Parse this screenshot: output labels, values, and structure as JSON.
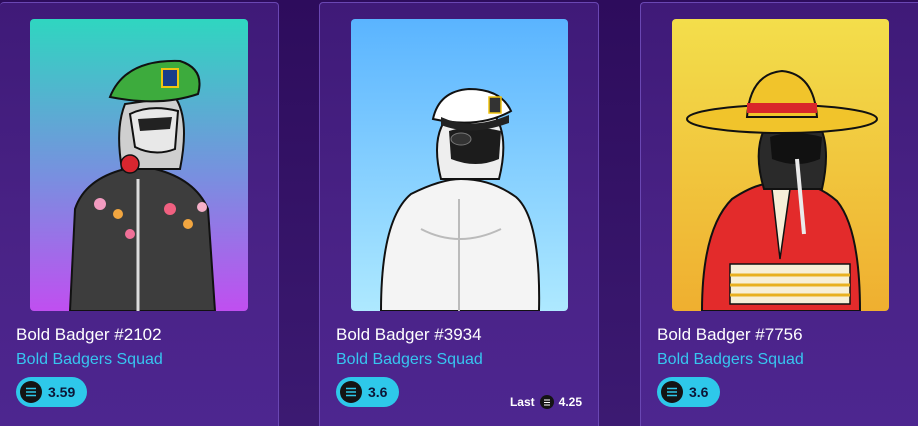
{
  "cards": [
    {
      "title": "Bold Badger #2102",
      "collection": "Bold Badgers Squad",
      "price": "3.59",
      "background": [
        "#2fd6c0",
        "#bd4cf0"
      ],
      "icon": "solana-icon"
    },
    {
      "title": "Bold Badger #3934",
      "collection": "Bold Badgers Squad",
      "price": "3.6",
      "last_label": "Last",
      "last_price": "4.25",
      "background": [
        "#5bb6ff",
        "#a8e6ff"
      ],
      "icon": "solana-icon"
    },
    {
      "title": "Bold Badger #7756",
      "collection": "Bold Badgers Squad",
      "price": "3.6",
      "background": [
        "#f4e04c",
        "#f0b030"
      ],
      "icon": "solana-icon"
    }
  ],
  "colors": {
    "accent_pill": "#2ec8ea",
    "collection_link": "#37c6f0",
    "card_border": "#6a47b3"
  }
}
